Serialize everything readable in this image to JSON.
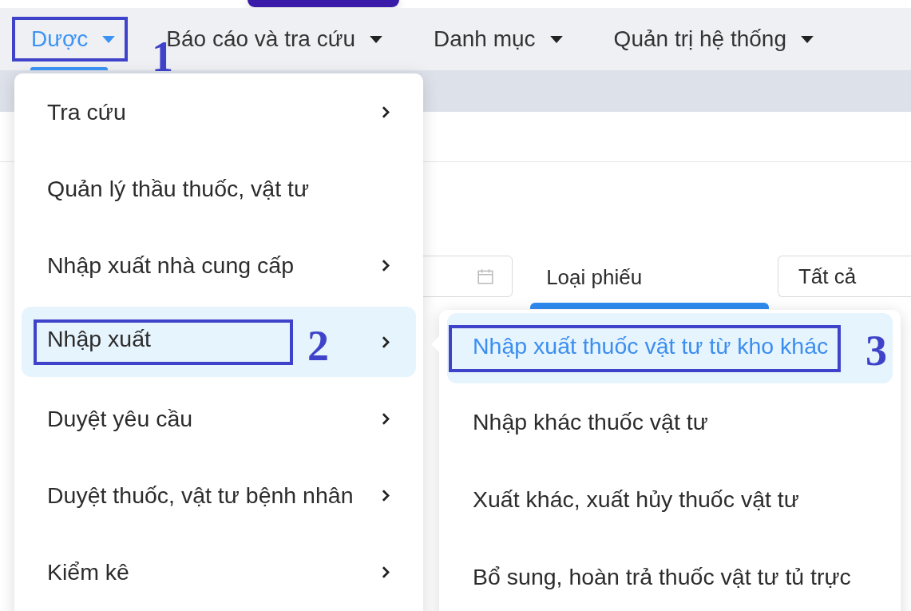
{
  "nav": [
    {
      "label": "Dược",
      "selected": true,
      "callout": "1"
    },
    {
      "label": "Báo cáo và tra cứu",
      "selected": false
    },
    {
      "label": "Danh mục",
      "selected": false
    },
    {
      "label": "Quản trị hệ thống",
      "selected": false
    }
  ],
  "page": {
    "filter_label": "Loại phiếu",
    "filter_value": "Tất cả"
  },
  "menu": {
    "items": [
      {
        "label": "Tra cứu",
        "has_submenu": true,
        "selected": false
      },
      {
        "label": "Quản lý thầu thuốc, vật tư",
        "has_submenu": false,
        "selected": false
      },
      {
        "label": "Nhập xuất nhà cung cấp",
        "has_submenu": true,
        "selected": false
      },
      {
        "label": "Nhập xuất",
        "has_submenu": true,
        "selected": true,
        "callout": "2"
      },
      {
        "label": "Duyệt yêu cầu",
        "has_submenu": true,
        "selected": false
      },
      {
        "label": "Duyệt thuốc, vật tư bệnh nhân",
        "has_submenu": true,
        "selected": false
      },
      {
        "label": "Kiểm kê",
        "has_submenu": true,
        "selected": false
      }
    ]
  },
  "submenu": {
    "items": [
      {
        "label": "Nhập xuất thuốc vật tư từ kho khác",
        "selected": true,
        "callout": "3"
      },
      {
        "label": "Nhập khác thuốc vật tư",
        "selected": false
      },
      {
        "label": "Xuất khác, xuất hủy thuốc vật tư",
        "selected": false
      },
      {
        "label": "Bổ sung, hoàn trả thuốc vật tư tủ trực",
        "selected": false
      }
    ]
  }
}
